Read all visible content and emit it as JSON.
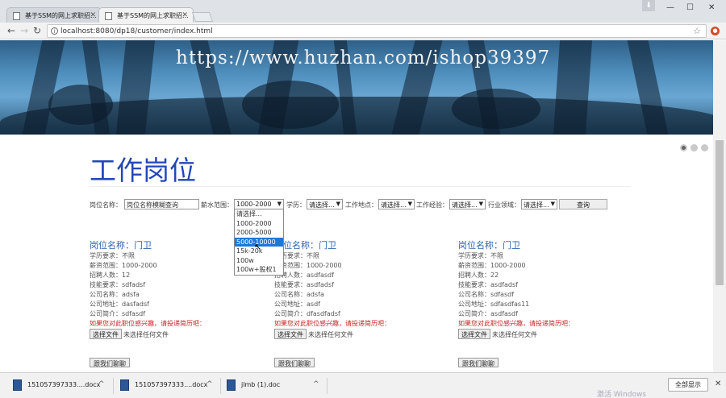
{
  "browser": {
    "tabs": [
      {
        "title": "基于SSM的网上求职招..."
      },
      {
        "title": "基于SSM的网上求职招..."
      }
    ],
    "url": "localhost:8080/dp18/customer/index.html",
    "icons": {
      "back": "arrow-left-icon",
      "forward": "arrow-right-icon",
      "reload": "reload-icon",
      "bookmark": "star-icon"
    }
  },
  "banner": {
    "watermark": "https://www.huzhan.com/ishop39397"
  },
  "page": {
    "title": "工作岗位"
  },
  "filters": {
    "position_label": "岗位名称：",
    "position_placeholder": "岗位名称模糊查询",
    "salary_label": "薪水范围：",
    "salary_value": "1000-2000",
    "education_label": "学历：",
    "education_value": "请选择...",
    "location_label": "工作地点：",
    "location_value": "请选择...",
    "experience_label": "工作经验：",
    "experience_value": "请选择...",
    "industry_label": "行业领域：",
    "industry_value": "请选择...",
    "search_button": "查询"
  },
  "salary_dropdown": {
    "options": [
      "请选择...",
      "1000-2000",
      "2000-5000",
      "5000-10000",
      "15k-20k",
      "100w",
      "100w+股权1"
    ],
    "highlighted": "5000-10000"
  },
  "jobs": [
    {
      "title": "岗位名称：门卫",
      "education": "学历要求：不限",
      "salary": "薪资范围：1000-2000",
      "headcount": "招聘人数：12",
      "skills": "技能要求：sdfadsf",
      "company": "公司名称：adsfa",
      "address": "公司地址：dasfadsf",
      "intro": "公司简介：sdfasdf",
      "note": "如果您对此职位感兴趣，请投递简历吧：",
      "file_button": "选择文件",
      "file_status": "未选择任何文件",
      "contact_button": "跟我们聊聊"
    },
    {
      "title": "岗位名称：门卫",
      "education": "学历要求：不限",
      "salary": "薪资范围：1000-2000",
      "headcount": "招聘人数：asdfasdf",
      "skills": "技能要求：asdfadsf",
      "company": "公司名称：adsfa",
      "address": "公司地址：asdf",
      "intro": "公司简介：dfasdfadsf",
      "note": "如果您对此职位感兴趣，请投递简历吧：",
      "file_button": "选择文件",
      "file_status": "未选择任何文件",
      "contact_button": "跟我们聊聊"
    },
    {
      "title": "岗位名称：门卫",
      "education": "学历要求：不限",
      "salary": "薪资范围：1000-2000",
      "headcount": "招聘人数：22",
      "skills": "技能要求：asdfadsf",
      "company": "公司名称：sdfasdf",
      "address": "公司地址：sdfasdfas11",
      "intro": "公司简介：asdfasdf",
      "note": "如果您对此职位感兴趣，请投递简历吧：",
      "file_button": "选择文件",
      "file_status": "未选择任何文件",
      "contact_button": "跟我们聊聊"
    }
  ],
  "downloads": {
    "items": [
      {
        "name": "151057397333....docx"
      },
      {
        "name": "151057397333....docx"
      },
      {
        "name": "jlmb (1).doc"
      }
    ],
    "show_all": "全部显示"
  },
  "os_watermark": "激活 Windows",
  "colors": {
    "title_blue": "#2347b9",
    "link_blue": "#2f63b0",
    "note_red": "#c91f1f",
    "highlight": "#1e78d7"
  }
}
